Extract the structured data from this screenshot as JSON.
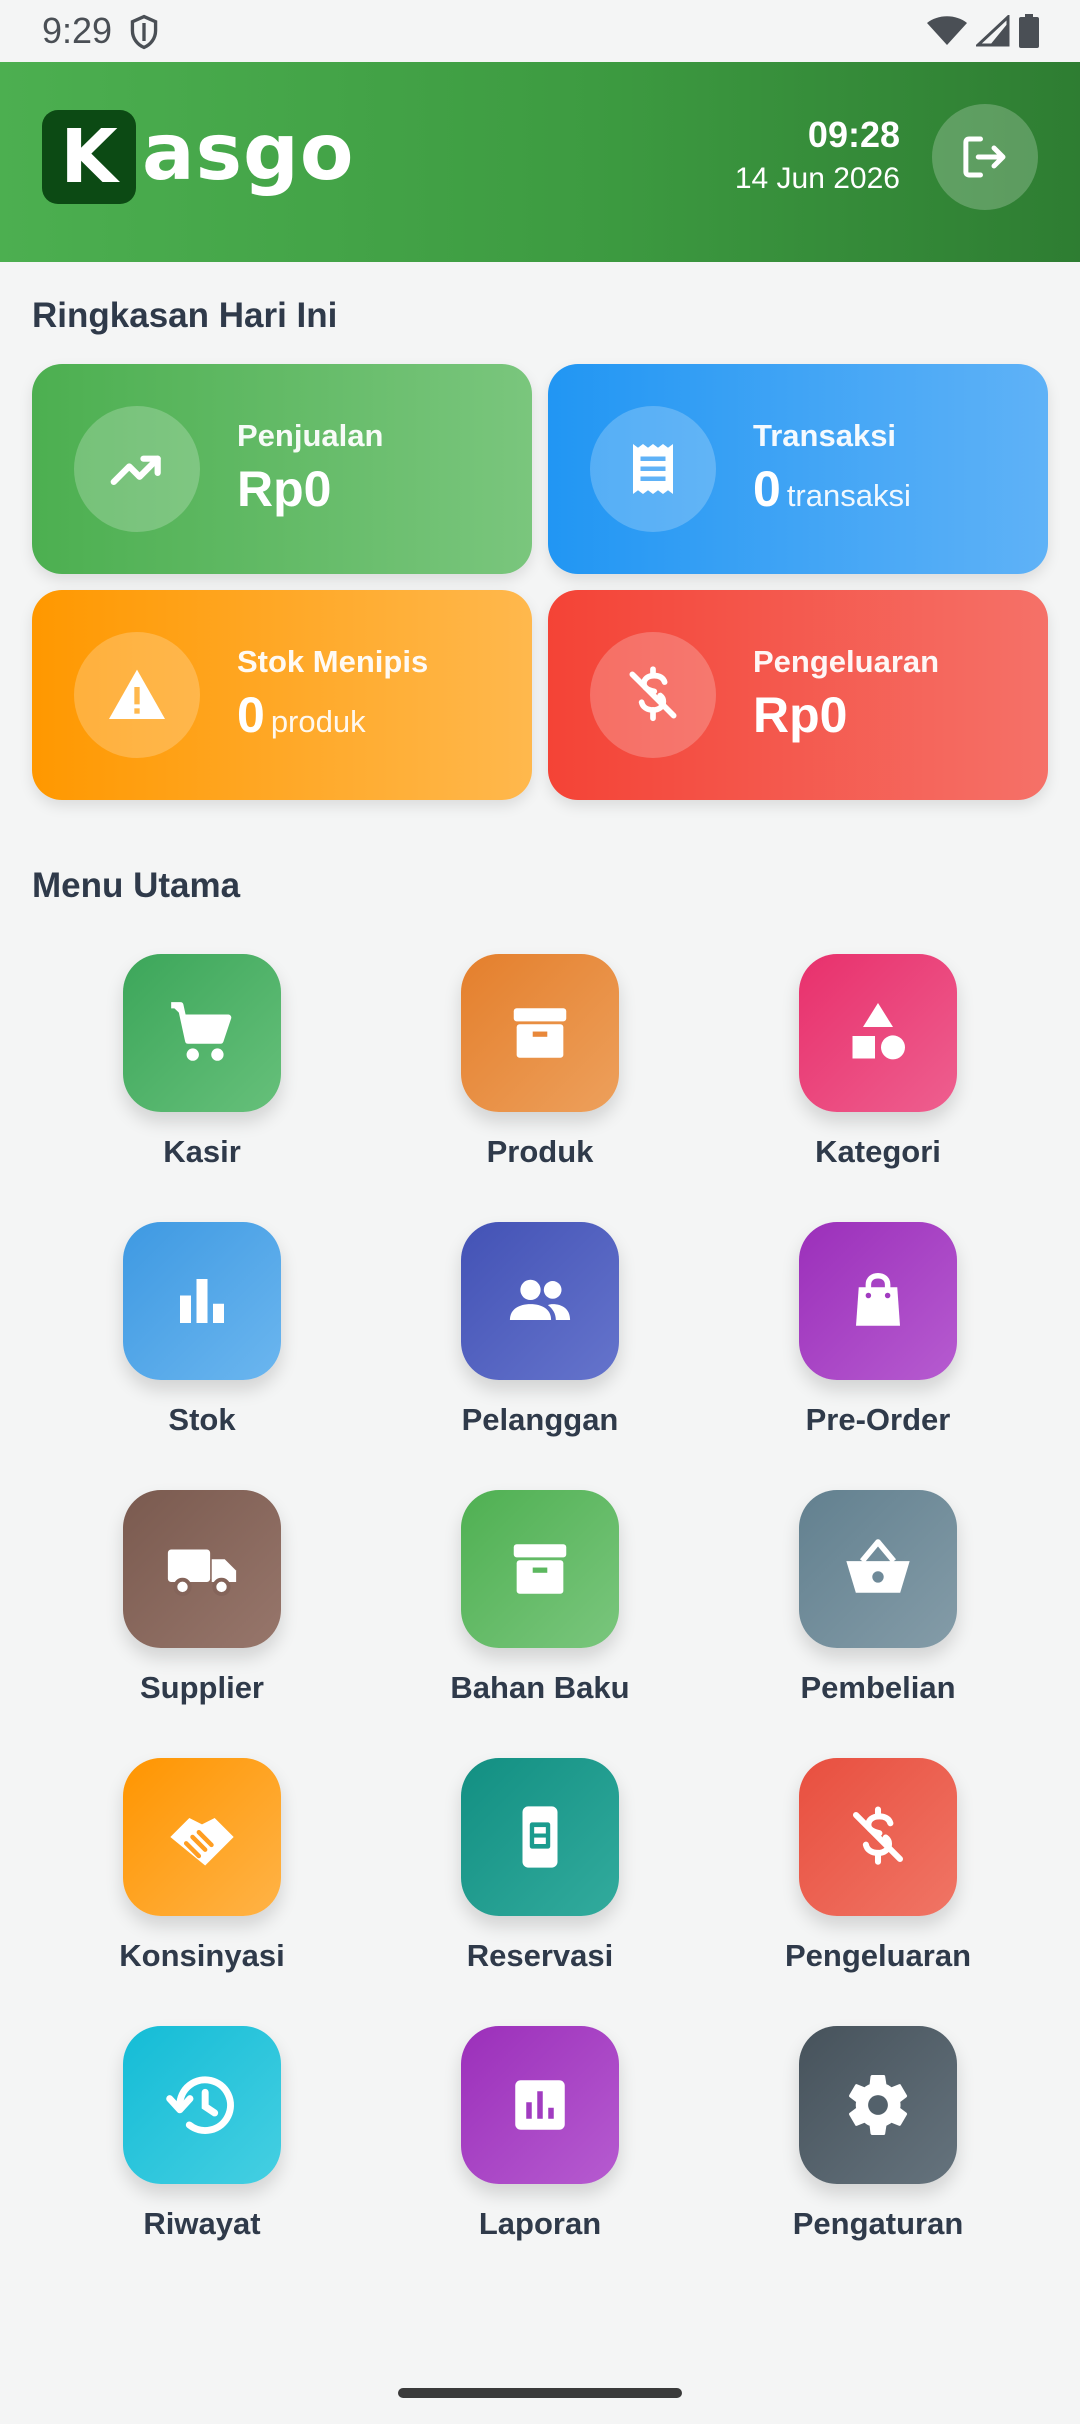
{
  "status_bar": {
    "time": "9:29",
    "icons": [
      "shield-icon",
      "wifi-icon",
      "signal-icon",
      "battery-icon"
    ]
  },
  "header": {
    "logo_letter": "K",
    "logo_text": "asgo",
    "time": "09:28",
    "date": "14 Jun 2026",
    "logout_icon": "logout-icon",
    "colors": {
      "gradient_start": "#4caf50",
      "gradient_end": "#2e7d32",
      "logo_bg": "#0c4a14"
    }
  },
  "summary": {
    "title": "Ringkasan Hari Ini",
    "cards": [
      {
        "label": "Penjualan",
        "value": "Rp0",
        "unit": "",
        "icon": "trending-up-icon",
        "color": "#4caf50"
      },
      {
        "label": "Transaksi",
        "value": "0",
        "unit": "transaksi",
        "icon": "receipt-icon",
        "color": "#2196f3"
      },
      {
        "label": "Stok Menipis",
        "value": "0",
        "unit": "produk",
        "icon": "warning-icon",
        "color": "#ff9800"
      },
      {
        "label": "Pengeluaran",
        "value": "Rp0",
        "unit": "",
        "icon": "money-off-icon",
        "color": "#f44336"
      }
    ]
  },
  "menu": {
    "title": "Menu Utama",
    "items": [
      {
        "label": "Kasir",
        "icon": "cart-icon",
        "color": "#43a860"
      },
      {
        "label": "Produk",
        "icon": "archive-box-icon",
        "color": "#e8883a"
      },
      {
        "label": "Kategori",
        "icon": "shapes-icon",
        "color": "#e9407a"
      },
      {
        "label": "Stok",
        "icon": "bar-chart-icon",
        "color": "#4aa3e8"
      },
      {
        "label": "Pelanggan",
        "icon": "people-icon",
        "color": "#4f5fbd"
      },
      {
        "label": "Pre-Order",
        "icon": "shopping-bag-icon",
        "color": "#a13cc0"
      },
      {
        "label": "Supplier",
        "icon": "truck-icon",
        "color": "#84645a"
      },
      {
        "label": "Bahan Baku",
        "icon": "archive-box-icon",
        "color": "#5cb85f"
      },
      {
        "label": "Pembelian",
        "icon": "basket-icon",
        "color": "#6f8a99"
      },
      {
        "label": "Konsinyasi",
        "icon": "handshake-icon",
        "color": "#ff9e22"
      },
      {
        "label": "Reservasi",
        "icon": "phone-booking-icon",
        "color": "#1a9c8e"
      },
      {
        "label": "Pengeluaran",
        "icon": "money-off-icon",
        "color": "#ec5a4a"
      },
      {
        "label": "Riwayat",
        "icon": "history-icon",
        "color": "#1ec1d8"
      },
      {
        "label": "Laporan",
        "icon": "report-icon",
        "color": "#a13cc0"
      },
      {
        "label": "Pengaturan",
        "icon": "gear-icon",
        "color": "#53616b"
      }
    ]
  }
}
